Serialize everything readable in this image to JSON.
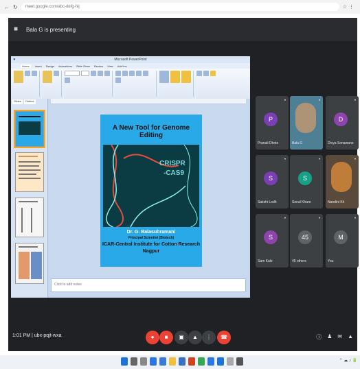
{
  "browser": {
    "url": "meet.google.com/abc-defg-hij"
  },
  "meet": {
    "presenter_label": "Bala G is presenting",
    "footer_time": "1:01 PM | ubx-pqjt-wxa"
  },
  "powerpoint": {
    "title": "Microsoft PowerPoint",
    "tabs": [
      "Home",
      "Insert",
      "Design",
      "Animations",
      "Slide Show",
      "Review",
      "View",
      "Add-Ins"
    ],
    "thumb_tabs": [
      "Slides",
      "Outline"
    ],
    "notes_placeholder": "Click to add notes"
  },
  "slide": {
    "title": "A New Tool for Genome Editing",
    "image_text_line1": "CRISPR",
    "image_text_line2": "-CAS9",
    "author": "Dr. G. Balasubramani",
    "role": "Principal Scientist (Biotech)",
    "institute": "ICAR-Central Institute for Cotton Research",
    "place": "Nagpur"
  },
  "participants": [
    {
      "name": "Pranali Dhote",
      "initial": "P",
      "color": "#7b3fb5",
      "type": "avatar"
    },
    {
      "name": "Bala G",
      "initial": "",
      "color": "#4d7f95",
      "type": "video"
    },
    {
      "name": "Divya Sonawane",
      "initial": "D",
      "color": "#8e44ad",
      "type": "avatar"
    },
    {
      "name": "Sakshi Lodh",
      "initial": "S",
      "color": "#7b3fb5",
      "type": "avatar"
    },
    {
      "name": "Sonal Khare",
      "initial": "S",
      "color": "#16a085",
      "type": "avatar"
    },
    {
      "name": "Nandini Kh",
      "initial": "",
      "color": "#5a4a3c",
      "type": "video"
    },
    {
      "name": "Sam Kale",
      "initial": "S",
      "color": "#8e44ad",
      "type": "avatar"
    },
    {
      "name": "45 others",
      "initial": "45",
      "color": "#5f6368",
      "type": "avatar"
    },
    {
      "name": "You",
      "initial": "M",
      "color": "#5f6368",
      "type": "avatar"
    }
  ],
  "colors": {
    "meet_bg": "#202124",
    "tile_bg": "#3c4043",
    "slide_bg": "#29a9e8",
    "end_call": "#ea4335"
  }
}
